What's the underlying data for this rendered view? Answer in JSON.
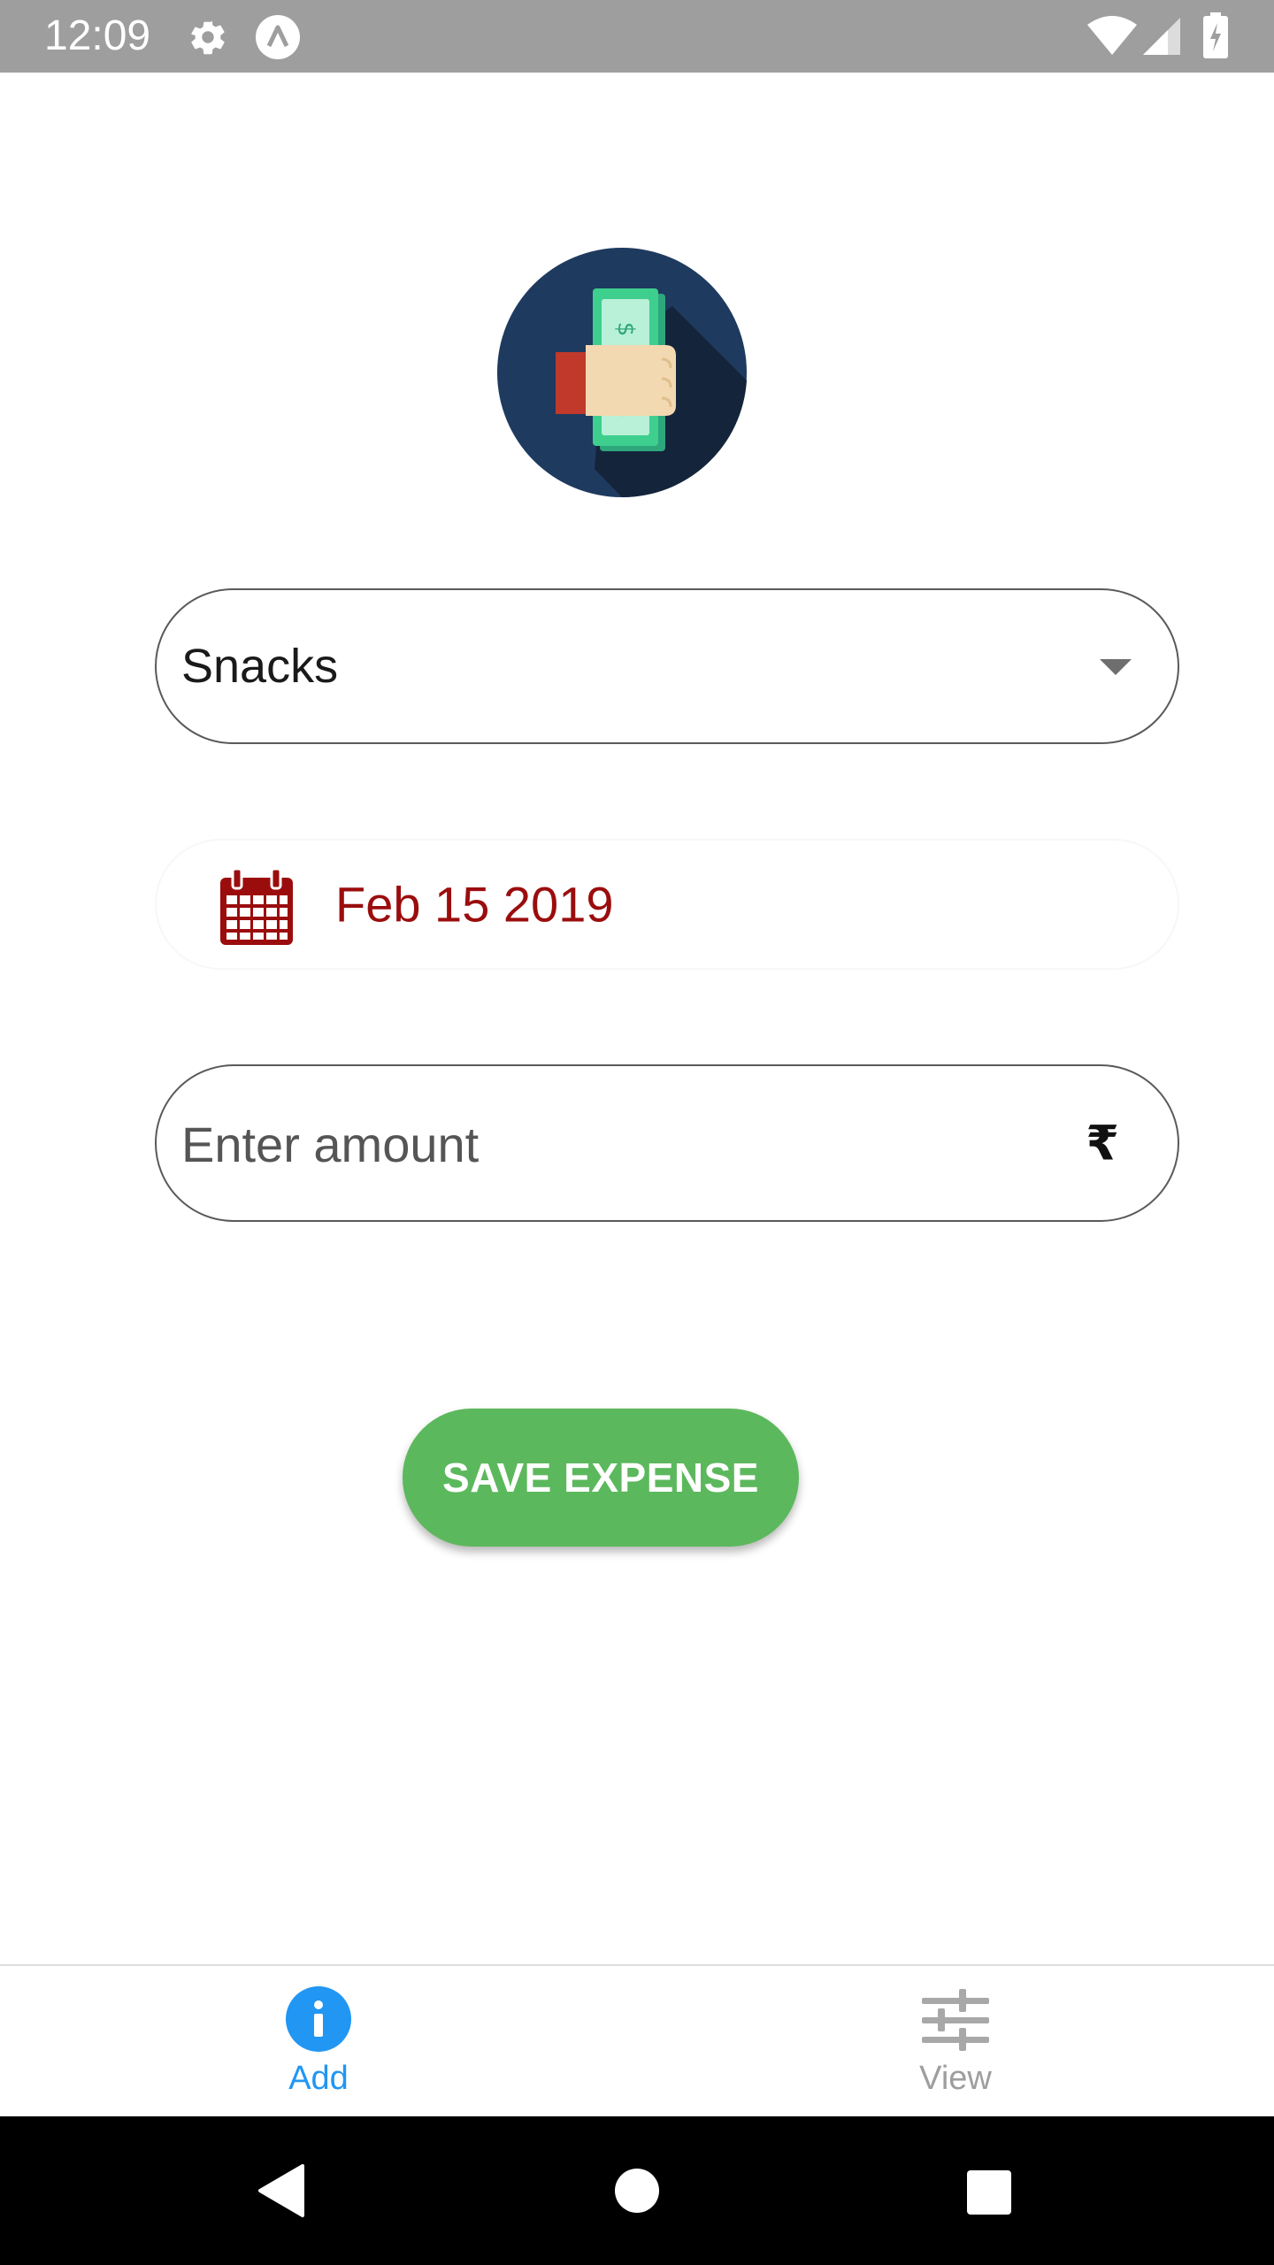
{
  "status_bar": {
    "time": "12:09",
    "icons": [
      "gear-icon",
      "a-circle-icon",
      "wifi-icon",
      "signal-icon",
      "battery-charging-icon"
    ]
  },
  "logo": {
    "icon": "hand-holding-money-icon",
    "colors": {
      "circle": "#1e3a5f",
      "sleeve": "#c0392b",
      "hand": "#f3d9b1",
      "bill": "#3ecf8e"
    }
  },
  "form": {
    "category": {
      "selected": "Snacks",
      "icon": "caret-down-icon"
    },
    "date": {
      "value": "Feb 15 2019",
      "icon": "calendar-icon",
      "color": "#9b0d0d"
    },
    "amount": {
      "value": "",
      "placeholder": "Enter amount",
      "currency_symbol": "₹"
    },
    "save_label": "SAVE EXPENSE",
    "save_color": "#5cb85c"
  },
  "tabs": [
    {
      "label": "Add",
      "icon": "info-icon",
      "active": true,
      "color": "#2196f3"
    },
    {
      "label": "View",
      "icon": "sliders-icon",
      "active": false,
      "color": "#9e9e9e"
    }
  ],
  "nav_bar": {
    "buttons": [
      "back-icon",
      "home-icon",
      "recents-icon"
    ]
  }
}
